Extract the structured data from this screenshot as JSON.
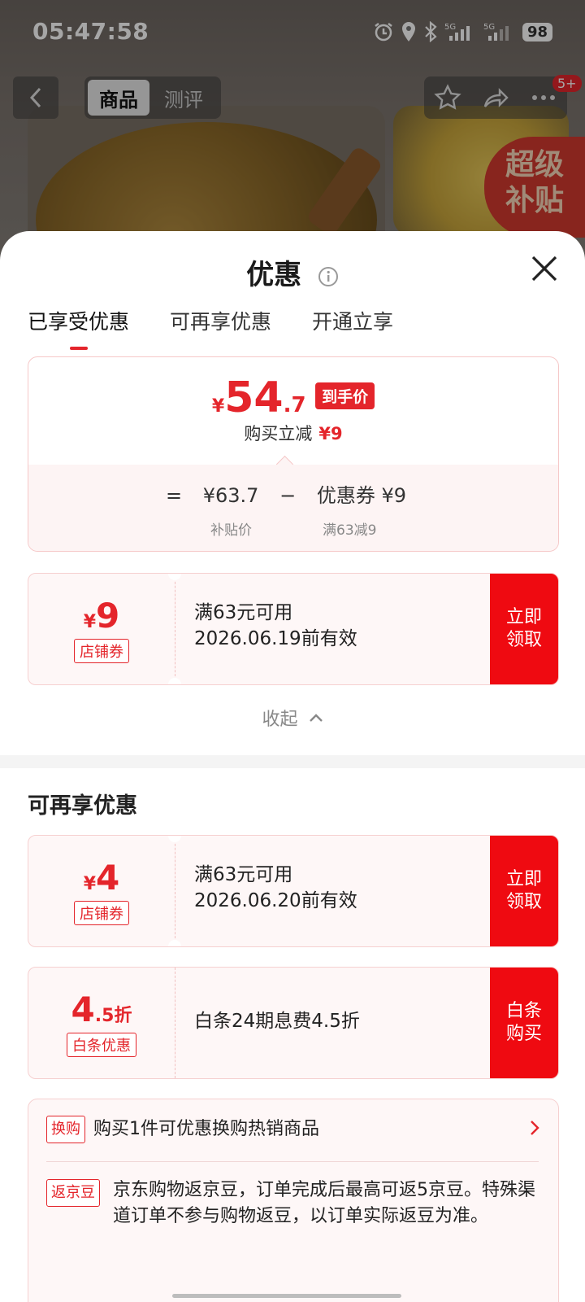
{
  "status_bar": {
    "time": "05:47:58",
    "battery": "98",
    "signal1": "5G",
    "signal2": "5G"
  },
  "product_nav": {
    "tab_product": "商品",
    "tab_review": "测评",
    "cart_count": "5+",
    "promo_badge_line1": "超级",
    "promo_badge_line2": "补贴"
  },
  "sheet": {
    "title": "优惠",
    "tabs": [
      "已享受优惠",
      "可再享优惠",
      "开通立享"
    ],
    "summary": {
      "currency": "¥",
      "price_int": "54",
      "price_dec": ".7",
      "price_tag": "到手价",
      "reduce_label": "购买立减",
      "reduce_value": "¥9",
      "equals": "=",
      "orig_price": "¥63.7",
      "minus": "−",
      "coupon_label": "优惠券 ¥9",
      "orig_price_sub": "补贴价",
      "coupon_sub": "满63减9"
    },
    "coupon1": {
      "currency": "¥",
      "amount": "9",
      "kind": "店铺券",
      "condition": "满63元可用",
      "valid": "2026.06.19前有效",
      "button": "立即领取"
    },
    "collapse_label": "收起",
    "section2_title": "可再享优惠",
    "coupon2": {
      "currency": "¥",
      "amount": "4",
      "kind": "店铺券",
      "condition": "满63元可用",
      "valid": "2026.06.20前有效",
      "button": "立即领取"
    },
    "coupon3": {
      "amount": "4",
      "suffix": ".5折",
      "kind": "白条优惠",
      "desc": "白条24期息费4.5折",
      "button": "白条购买"
    },
    "extras": {
      "exchange_tag": "换购",
      "exchange_text": "购买1件可优惠换购热销商品",
      "bean_tag": "返京豆",
      "bean_text": "京东购物返京豆，订单完成后最高可返5京豆。特殊渠道订单不参与购物返豆，以订单实际返豆为准。"
    }
  },
  "colors": {
    "accent": "#e4252b",
    "button_red": "#ef0a11",
    "coupon_bg": "#fef7f7"
  }
}
